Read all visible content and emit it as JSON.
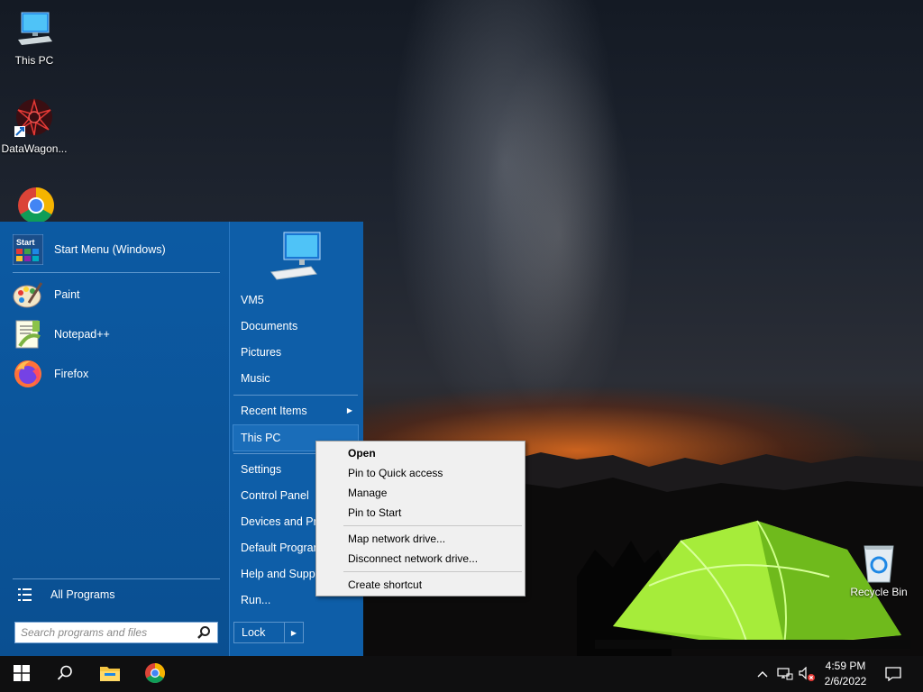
{
  "desktop": {
    "icons": [
      {
        "label": "This PC"
      },
      {
        "label": "DataWagon..."
      },
      {
        "label": "Google Chrome"
      },
      {
        "label": "Recycle Bin"
      }
    ]
  },
  "start_menu": {
    "pinned": [
      {
        "label": "Start Menu (Windows)"
      },
      {
        "label": "Paint"
      },
      {
        "label": "Notepad++"
      },
      {
        "label": "Firefox"
      }
    ],
    "start_icon_text": "Start",
    "all_programs": "All Programs",
    "search_placeholder": "Search programs and files",
    "right_items": [
      {
        "label": "VM5"
      },
      {
        "label": "Documents"
      },
      {
        "label": "Pictures"
      },
      {
        "label": "Music"
      },
      {
        "label": "Recent Items"
      },
      {
        "label": "This PC"
      },
      {
        "label": "Settings"
      },
      {
        "label": "Control Panel"
      },
      {
        "label": "Devices and Printers"
      },
      {
        "label": "Default Programs"
      },
      {
        "label": "Help and Support"
      },
      {
        "label": "Run..."
      }
    ],
    "lock_label": "Lock"
  },
  "context_menu": {
    "items": [
      {
        "label": "Open"
      },
      {
        "label": "Pin to Quick access"
      },
      {
        "label": "Manage"
      },
      {
        "label": "Pin to Start"
      },
      {
        "label": "Map network drive..."
      },
      {
        "label": "Disconnect network drive..."
      },
      {
        "label": "Create shortcut"
      }
    ]
  },
  "taskbar": {
    "time": "4:59 PM",
    "date": "2/6/2022"
  },
  "colors": {
    "start_menu_bg": "#0b5394",
    "accent": "#1a6db9",
    "taskbar_bg": "#0f0f10",
    "context_menu_bg": "#f0f0f0"
  },
  "icons": {
    "start": "windows-logo-icon",
    "search": "search-icon",
    "explorer": "folder-icon",
    "browser": "chrome-icon",
    "notifications": "notification-icon"
  }
}
